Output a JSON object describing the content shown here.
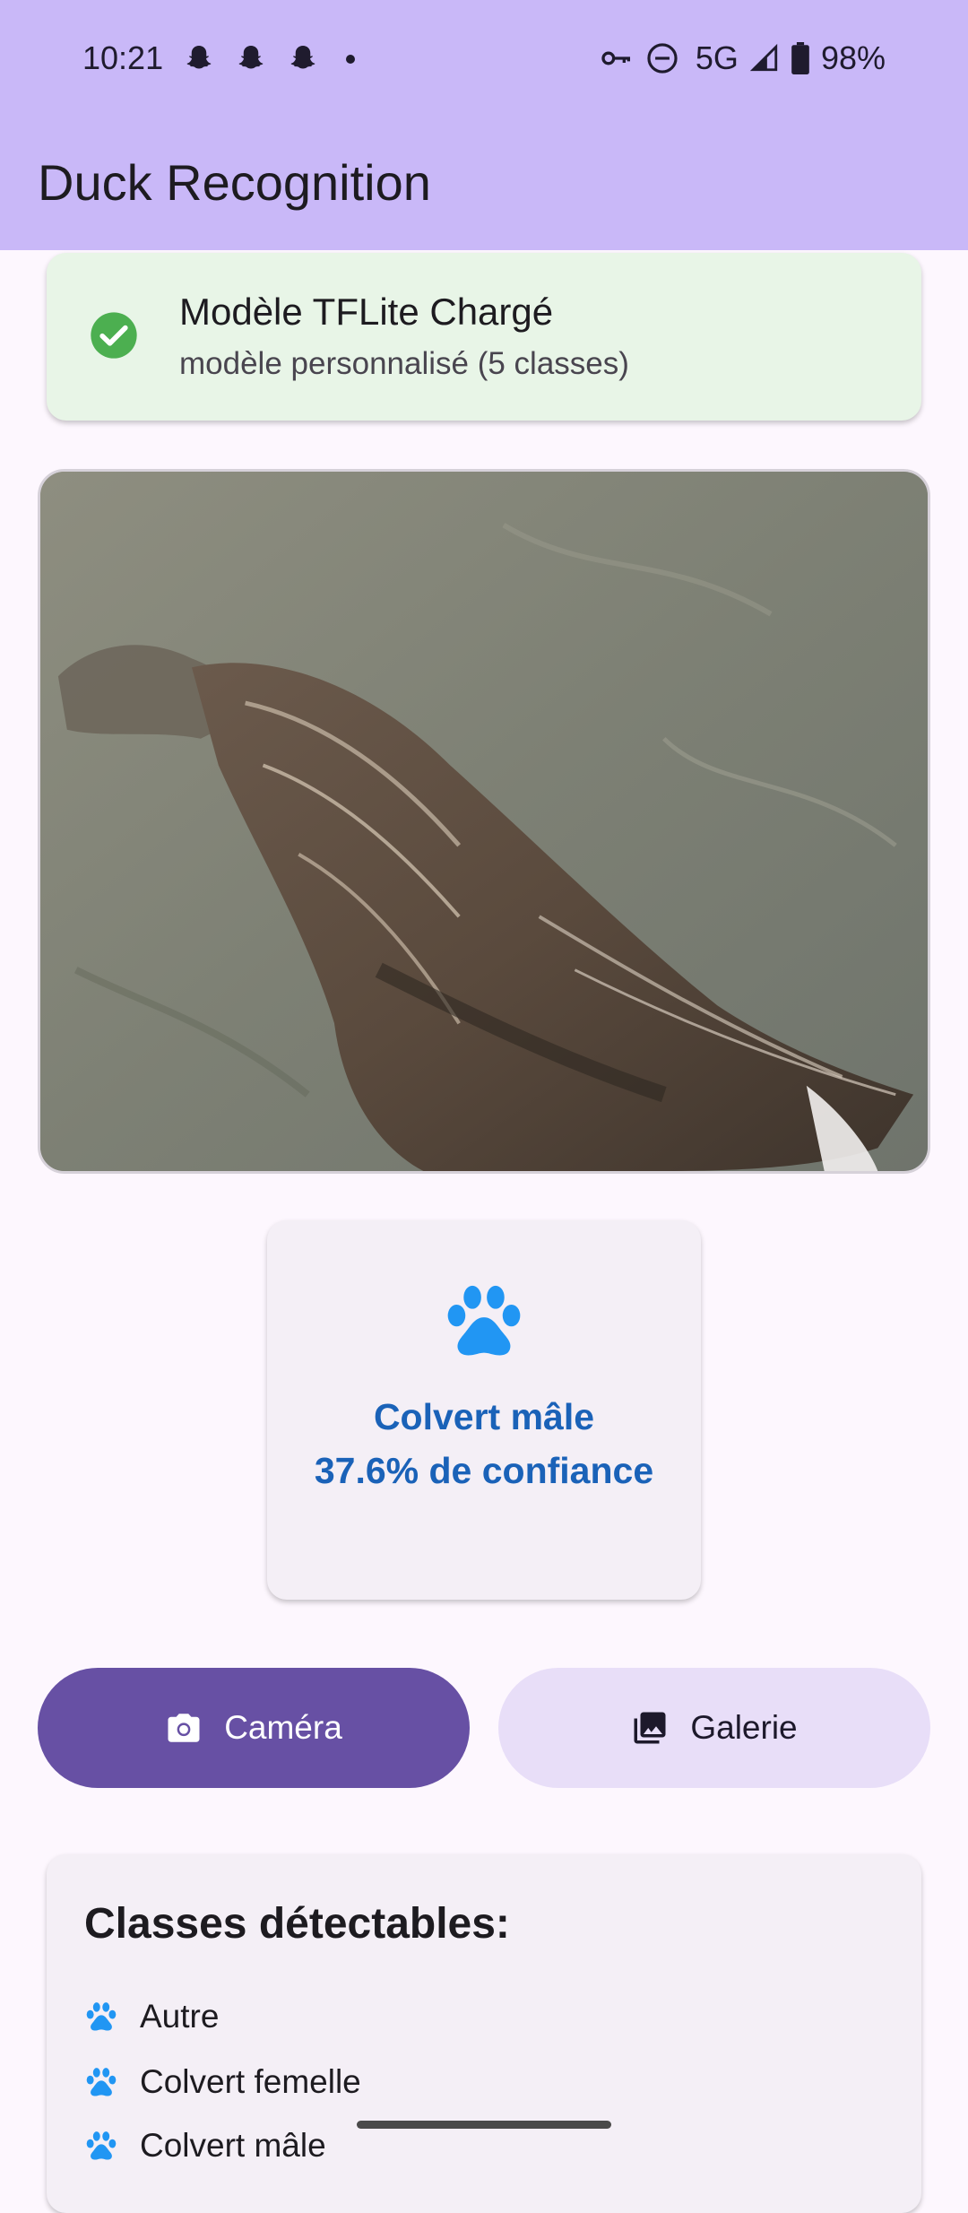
{
  "status_bar": {
    "time": "10:21",
    "network": "5G",
    "battery": "98%",
    "notification_icons": [
      "snapchat-icon",
      "snapchat-icon",
      "snapchat-icon"
    ]
  },
  "app_bar": {
    "title": "Duck Recognition"
  },
  "model_status": {
    "title": "Modèle TFLite Chargé",
    "subtitle": "modèle personnalisé (5 classes)",
    "icon": "check-circle-icon",
    "color": "#4caf50"
  },
  "result": {
    "label": "Colvert mâle",
    "confidence": "37.6% de confiance",
    "icon": "paw-icon",
    "color": "#1a62b8"
  },
  "buttons": {
    "camera": "Caméra",
    "gallery": "Galerie"
  },
  "classes": {
    "title": "Classes détectables:",
    "items": [
      "Autre",
      "Colvert femelle",
      "Colvert mâle"
    ]
  },
  "colors": {
    "app_bar": "#c9b8f8",
    "primary": "#6750a4",
    "secondary_container": "#e8def8",
    "icon_blue": "#2196f3"
  }
}
